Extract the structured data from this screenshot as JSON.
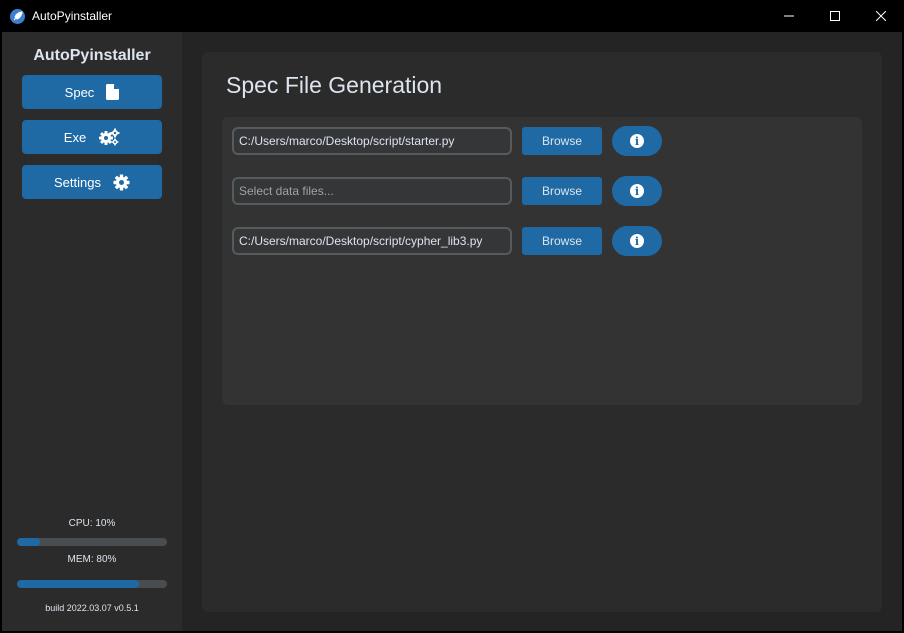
{
  "window": {
    "title": "AutoPyinstaller"
  },
  "colors": {
    "accent": "#1f6aa5",
    "sidebar_bg": "#2b2b2b",
    "panel_bg": "#333333",
    "window_bg": "#242424"
  },
  "sidebar": {
    "title": "AutoPyinstaller",
    "items": [
      {
        "label": "Spec",
        "icon": "file-icon"
      },
      {
        "label": "Exe",
        "icon": "gears-icon"
      },
      {
        "label": "Settings",
        "icon": "gear-icon"
      }
    ],
    "cpu": {
      "label": "CPU: 10%",
      "value": 0.15
    },
    "mem": {
      "label": "MEM: 80%",
      "value": 0.81
    },
    "build": "build 2022.03.07 v0.5.1"
  },
  "main": {
    "title": "Spec File Generation",
    "rows": [
      {
        "value": "C:/Users/marco/Desktop/script/starter.py",
        "placeholder": "",
        "browse_label": "Browse"
      },
      {
        "value": "",
        "placeholder": "Select data files...",
        "browse_label": "Browse"
      },
      {
        "value": "C:/Users/marco/Desktop/script/cypher_lib3.py",
        "placeholder": "",
        "browse_label": "Browse"
      }
    ]
  }
}
